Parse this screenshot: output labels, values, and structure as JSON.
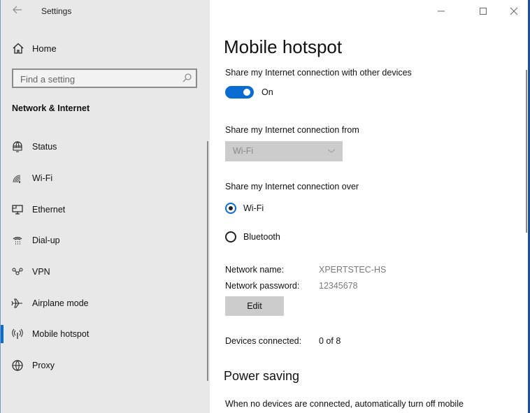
{
  "window": {
    "app_title": "Settings",
    "controls": {
      "minimize": "minimize-icon",
      "maximize": "maximize-icon",
      "close": "close-icon"
    }
  },
  "sidebar": {
    "back_icon": "back-arrow-icon",
    "home_label": "Home",
    "search": {
      "placeholder": "Find a setting",
      "value": ""
    },
    "section_title": "Network & Internet",
    "items": [
      {
        "label": "Status",
        "icon": "globe-monitor-icon",
        "active": false
      },
      {
        "label": "Wi-Fi",
        "icon": "wifi-icon",
        "active": false
      },
      {
        "label": "Ethernet",
        "icon": "ethernet-icon",
        "active": false
      },
      {
        "label": "Dial-up",
        "icon": "phone-icon",
        "active": false
      },
      {
        "label": "VPN",
        "icon": "vpn-icon",
        "active": false
      },
      {
        "label": "Airplane mode",
        "icon": "airplane-icon",
        "active": false
      },
      {
        "label": "Mobile hotspot",
        "icon": "hotspot-icon",
        "active": true
      },
      {
        "label": "Proxy",
        "icon": "globe-icon",
        "active": false
      }
    ]
  },
  "main": {
    "title": "Mobile hotspot",
    "share_label": "Share my Internet connection with other devices",
    "share_toggle": {
      "state": "On",
      "on": true
    },
    "share_from_label": "Share my Internet connection from",
    "share_from_selected": "Wi-Fi",
    "share_over_label": "Share my Internet connection over",
    "share_over_options": [
      {
        "label": "Wi-Fi",
        "checked": true
      },
      {
        "label": "Bluetooth",
        "checked": false
      }
    ],
    "network_name_label": "Network name:",
    "network_name": "XPERTSTEC-HS",
    "network_password_label": "Network password:",
    "network_password": "12345678",
    "edit_label": "Edit",
    "devices_label": "Devices connected:",
    "devices_value": "0 of 8",
    "power_saving_title": "Power saving",
    "power_saving_text": "When no devices are connected, automatically turn off mobile"
  },
  "colors": {
    "accent": "#0a6cd0",
    "sidebar_bg": "#e8e8e8",
    "disabled_bg": "#cccccc"
  }
}
